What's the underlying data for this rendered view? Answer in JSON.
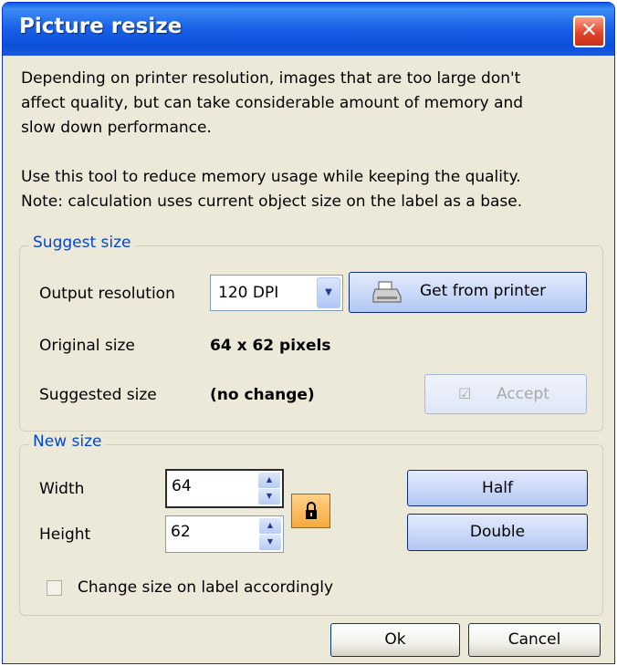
{
  "window": {
    "title": "Picture resize"
  },
  "description": {
    "lines": [
      "Depending on printer resolution, images that are too large don't",
      "affect quality, but can take considerable amount of memory and",
      "slow down performance.",
      "",
      "Use this tool to reduce memory usage while keeping the quality.",
      "Note: calculation uses current object size on the label as a base."
    ]
  },
  "suggest": {
    "legend": "Suggest size",
    "output_resolution_label": "Output resolution",
    "output_resolution_value": "120 DPI",
    "get_from_printer_label": "Get from printer",
    "original_size_label": "Original size",
    "original_size_value": "64 x 62 pixels",
    "suggested_size_label": "Suggested size",
    "suggested_size_value": "(no change)",
    "accept_label": "Accept"
  },
  "newsize": {
    "legend": "New size",
    "width_label": "Width",
    "width_value": "64",
    "height_label": "Height",
    "height_value": "62",
    "half_label": "Half",
    "double_label": "Double",
    "change_label": "Change size on label accordingly",
    "change_checked": false
  },
  "footer": {
    "ok_label": "Ok",
    "cancel_label": "Cancel"
  },
  "colors": {
    "titlebar": "#0b4fd8",
    "close": "#e0452a",
    "dialog_bg": "#ece9d8",
    "group_label": "#0046d5"
  }
}
